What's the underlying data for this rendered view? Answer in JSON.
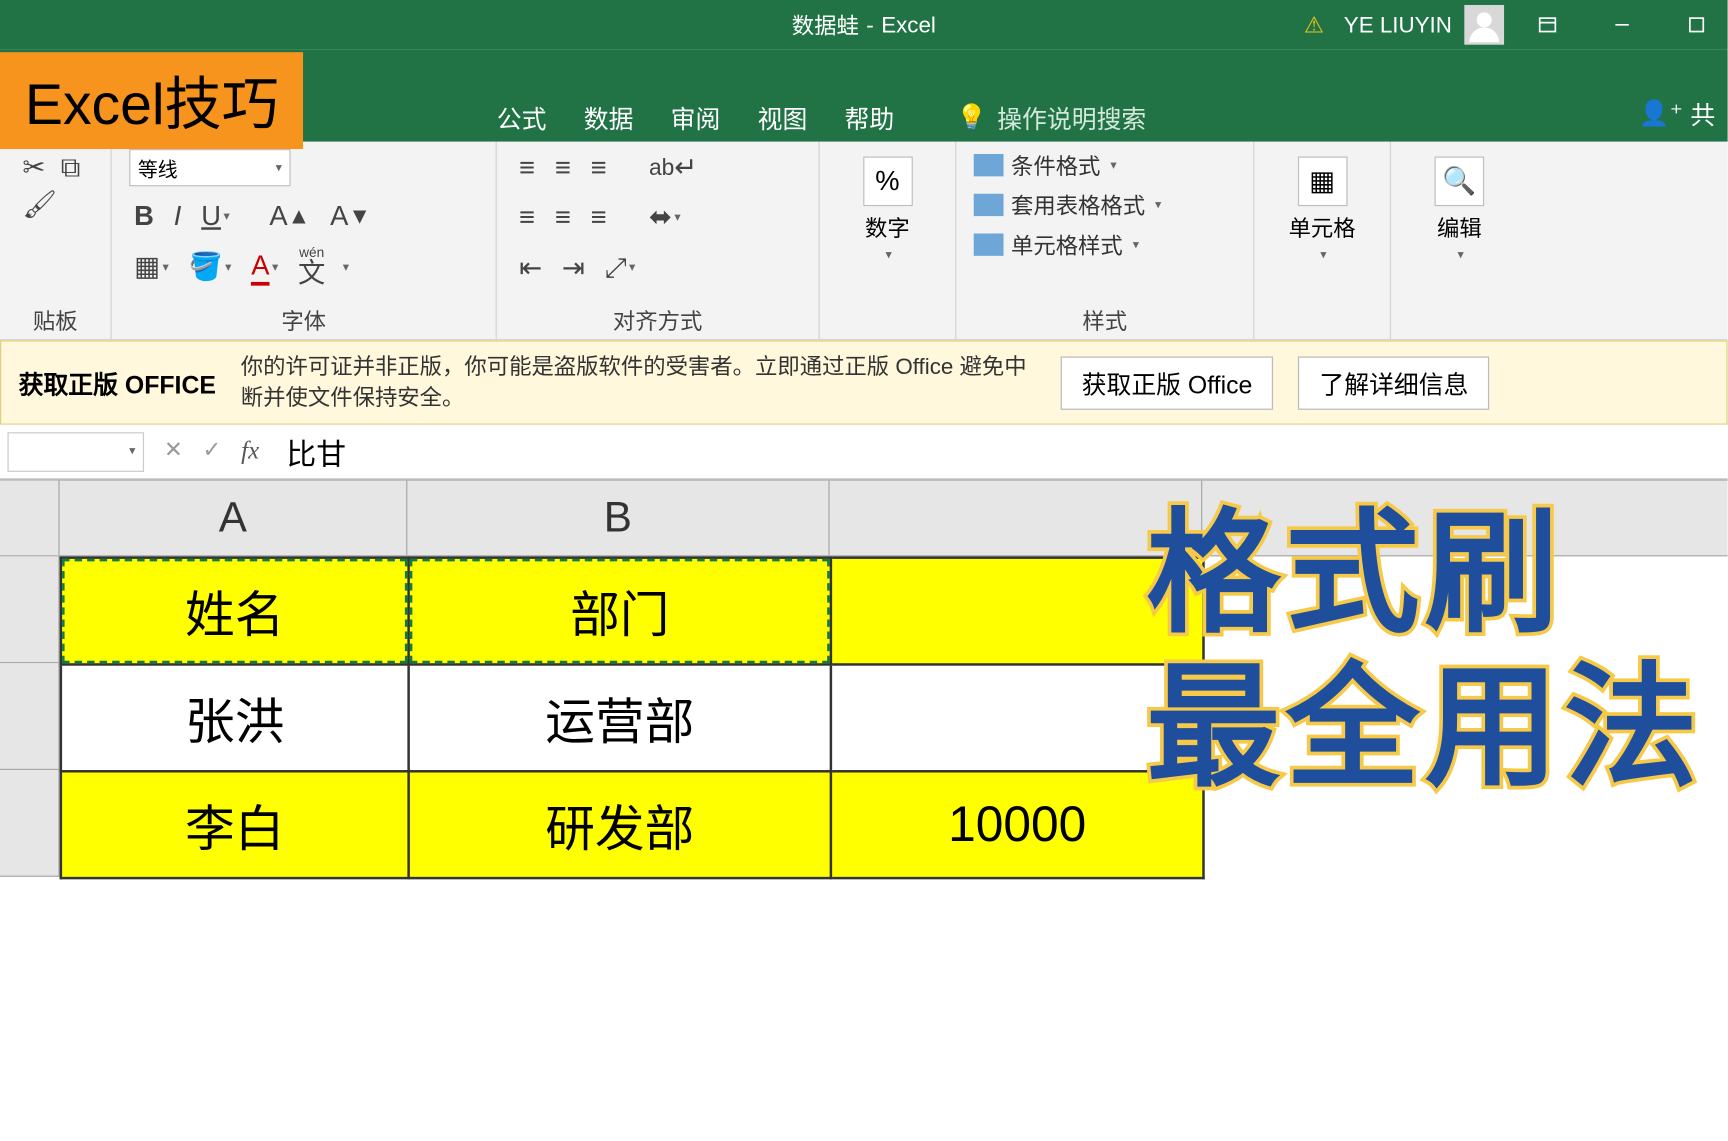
{
  "titlebar": {
    "doc_name": "数据蛙",
    "app_name": "Excel",
    "user_name": "YE LIUYIN"
  },
  "badge": {
    "text": "Excel技巧"
  },
  "tabs": {
    "formula": "公式",
    "data": "数据",
    "review": "审阅",
    "view": "视图",
    "help": "帮助",
    "tell_me": "操作说明搜索",
    "share": "共"
  },
  "ribbon": {
    "clipboard_label": "贴板",
    "font_name": "等线",
    "font_label": "字体",
    "align_label": "对齐方式",
    "wen": "wén",
    "wen_char": "文",
    "number_btn": "%",
    "number_label": "数字",
    "cond_fmt": "条件格式",
    "table_fmt": "套用表格格式",
    "cell_style": "单元格样式",
    "styles_label": "样式",
    "cells_btn": "单元格",
    "edit_btn": "编辑"
  },
  "license": {
    "title": "获取正版 OFFICE",
    "text": "你的许可证并非正版，你可能是盗版软件的受害者。立即通过正版 Office 避免中断并使文件保持安全。",
    "btn1": "获取正版 Office",
    "btn2": "了解详细信息"
  },
  "formula_bar": {
    "value": "比甘"
  },
  "columns": {
    "A": "A",
    "B": "B"
  },
  "rows": [
    {
      "A": "姓名",
      "B": "部门",
      "C": "",
      "yellow": true,
      "selected": true
    },
    {
      "A": "张洪",
      "B": "运营部",
      "C": "",
      "yellow": false
    },
    {
      "A": "李白",
      "B": "研发部",
      "C": "10000",
      "yellow": true
    }
  ],
  "overlay": {
    "line1": "格式刷",
    "line2": "最全用法"
  }
}
